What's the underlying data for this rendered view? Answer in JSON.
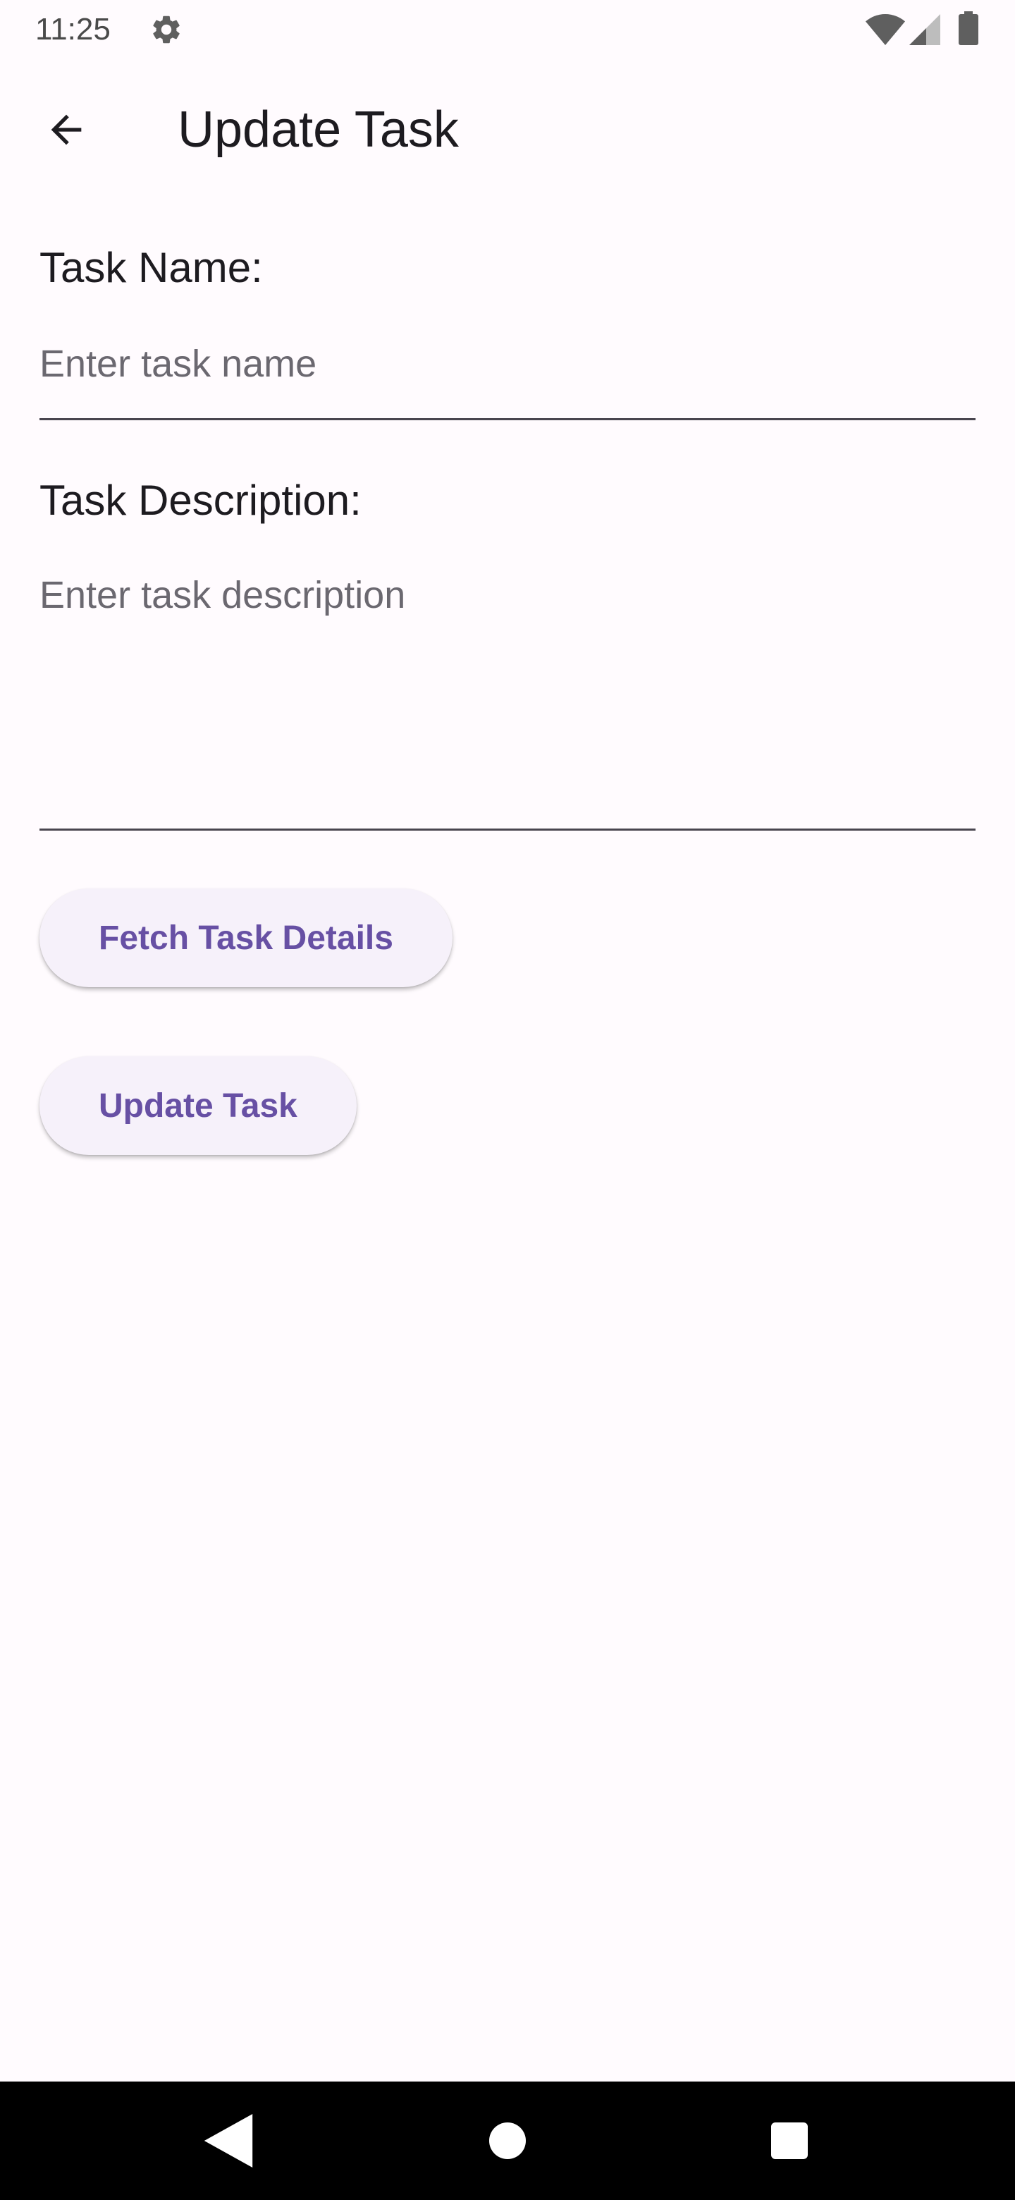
{
  "status_bar": {
    "time": "11:25",
    "icons": [
      "gear-icon",
      "wifi-icon",
      "cell-signal-icon",
      "battery-icon"
    ]
  },
  "app_bar": {
    "back_icon": "arrow-back-icon",
    "title": "Update Task"
  },
  "form": {
    "task_name": {
      "label": "Task Name:",
      "placeholder": "Enter task name",
      "value": ""
    },
    "task_description": {
      "label": "Task Description:",
      "placeholder": "Enter task description",
      "value": ""
    }
  },
  "buttons": {
    "fetch_label": "Fetch Task Details",
    "update_label": "Update Task"
  },
  "nav_bar": {
    "icons": [
      "nav-back-icon",
      "nav-home-icon",
      "nav-recents-icon"
    ]
  },
  "colors": {
    "background": "#fffbfe",
    "accent": "#6750a4",
    "button_surface": "#f6f1fa",
    "text": "#1d1b20",
    "placeholder": "#6b6870",
    "divider": "#49454f"
  }
}
